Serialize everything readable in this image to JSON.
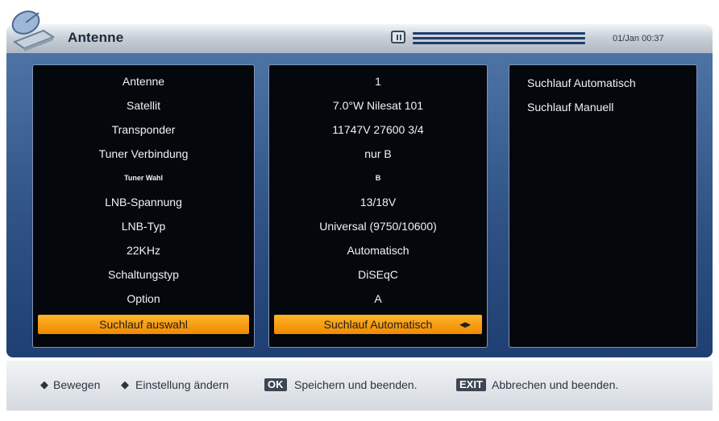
{
  "header": {
    "title": "Antenne",
    "datetime": "01/Jan 00:37"
  },
  "labels": [
    "Antenne",
    "Satellit",
    "Transponder",
    "Tuner Verbindung",
    "Tuner Wahl",
    "LNB-Spannung",
    "LNB-Typ",
    "22KHz",
    "Schaltungstyp",
    "Option",
    "Suchlauf auswahl"
  ],
  "values": [
    "1",
    "7.0°W Nilesat 101",
    "11747V 27600 3/4",
    "nur B",
    "B",
    "13/18V",
    "Universal (9750/10600)",
    "Automatisch",
    "DiSEqC",
    "A",
    "Suchlauf Automatisch"
  ],
  "options": [
    "Suchlauf Automatisch",
    "Suchlauf Manuell"
  ],
  "footer": {
    "move_label": "Bewegen",
    "change_label": "Einstellung ändern",
    "ok_key": "OK",
    "ok_label": "Speichern und beenden.",
    "exit_key": "EXIT",
    "exit_label": "Abbrechen und beenden."
  },
  "colors": {
    "accent": "#f08a00",
    "panel_bg": "#04070c",
    "main_blue": "#2d4f82"
  },
  "icons": {
    "logo": "satellite-dish-icon",
    "signal": "signal-icon",
    "move": "up-down-arrow-icon",
    "change": "left-right-arrow-icon"
  }
}
